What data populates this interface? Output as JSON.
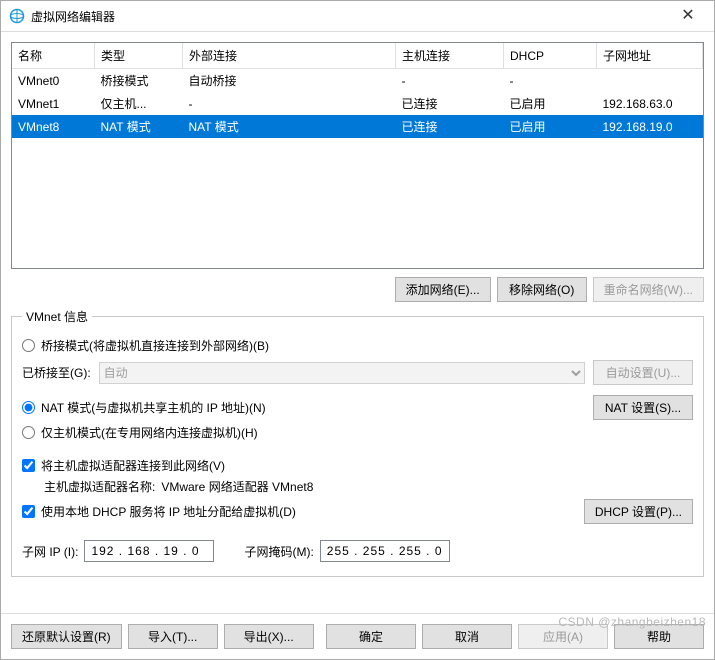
{
  "window": {
    "title": "虚拟网络编辑器"
  },
  "table": {
    "headers": [
      "名称",
      "类型",
      "外部连接",
      "主机连接",
      "DHCP",
      "子网地址"
    ],
    "rows": [
      {
        "name": "VMnet0",
        "type": "桥接模式",
        "ext": "自动桥接",
        "host": "-",
        "dhcp": "-",
        "subnet": "",
        "selected": false
      },
      {
        "name": "VMnet1",
        "type": "仅主机...",
        "ext": "-",
        "host": "已连接",
        "dhcp": "已启用",
        "subnet": "192.168.63.0",
        "selected": false
      },
      {
        "name": "VMnet8",
        "type": "NAT 模式",
        "ext": "NAT 模式",
        "host": "已连接",
        "dhcp": "已启用",
        "subnet": "192.168.19.0",
        "selected": true
      }
    ]
  },
  "buttons": {
    "add_net": "添加网络(E)...",
    "remove_net": "移除网络(O)",
    "rename_net": "重命名网络(W)...",
    "auto_settings": "自动设置(U)...",
    "nat_settings": "NAT 设置(S)...",
    "dhcp_settings": "DHCP 设置(P)...",
    "restore": "还原默认设置(R)",
    "import": "导入(T)...",
    "export": "导出(X)...",
    "ok": "确定",
    "cancel": "取消",
    "apply": "应用(A)",
    "help": "帮助"
  },
  "group": {
    "legend": "VMnet 信息",
    "radio_bridge": "桥接模式(将虚拟机直接连接到外部网络)(B)",
    "bridge_to_label": "已桥接至(G):",
    "bridge_to_value": "自动",
    "radio_nat": "NAT 模式(与虚拟机共享主机的 IP 地址)(N)",
    "radio_hostonly": "仅主机模式(在专用网络内连接虚拟机)(H)",
    "check_hostadapter": "将主机虚拟适配器连接到此网络(V)",
    "hostadapter_name_label": "主机虚拟适配器名称:",
    "hostadapter_name_value": "VMware 网络适配器 VMnet8",
    "check_dhcp": "使用本地 DHCP 服务将 IP 地址分配给虚拟机(D)",
    "subnet_ip_label": "子网 IP (I):",
    "subnet_ip_value": "192 . 168 . 19 . 0",
    "subnet_mask_label": "子网掩码(M):",
    "subnet_mask_value": "255 . 255 . 255 . 0"
  },
  "watermark": "CSDN @zhangbeizhen18"
}
